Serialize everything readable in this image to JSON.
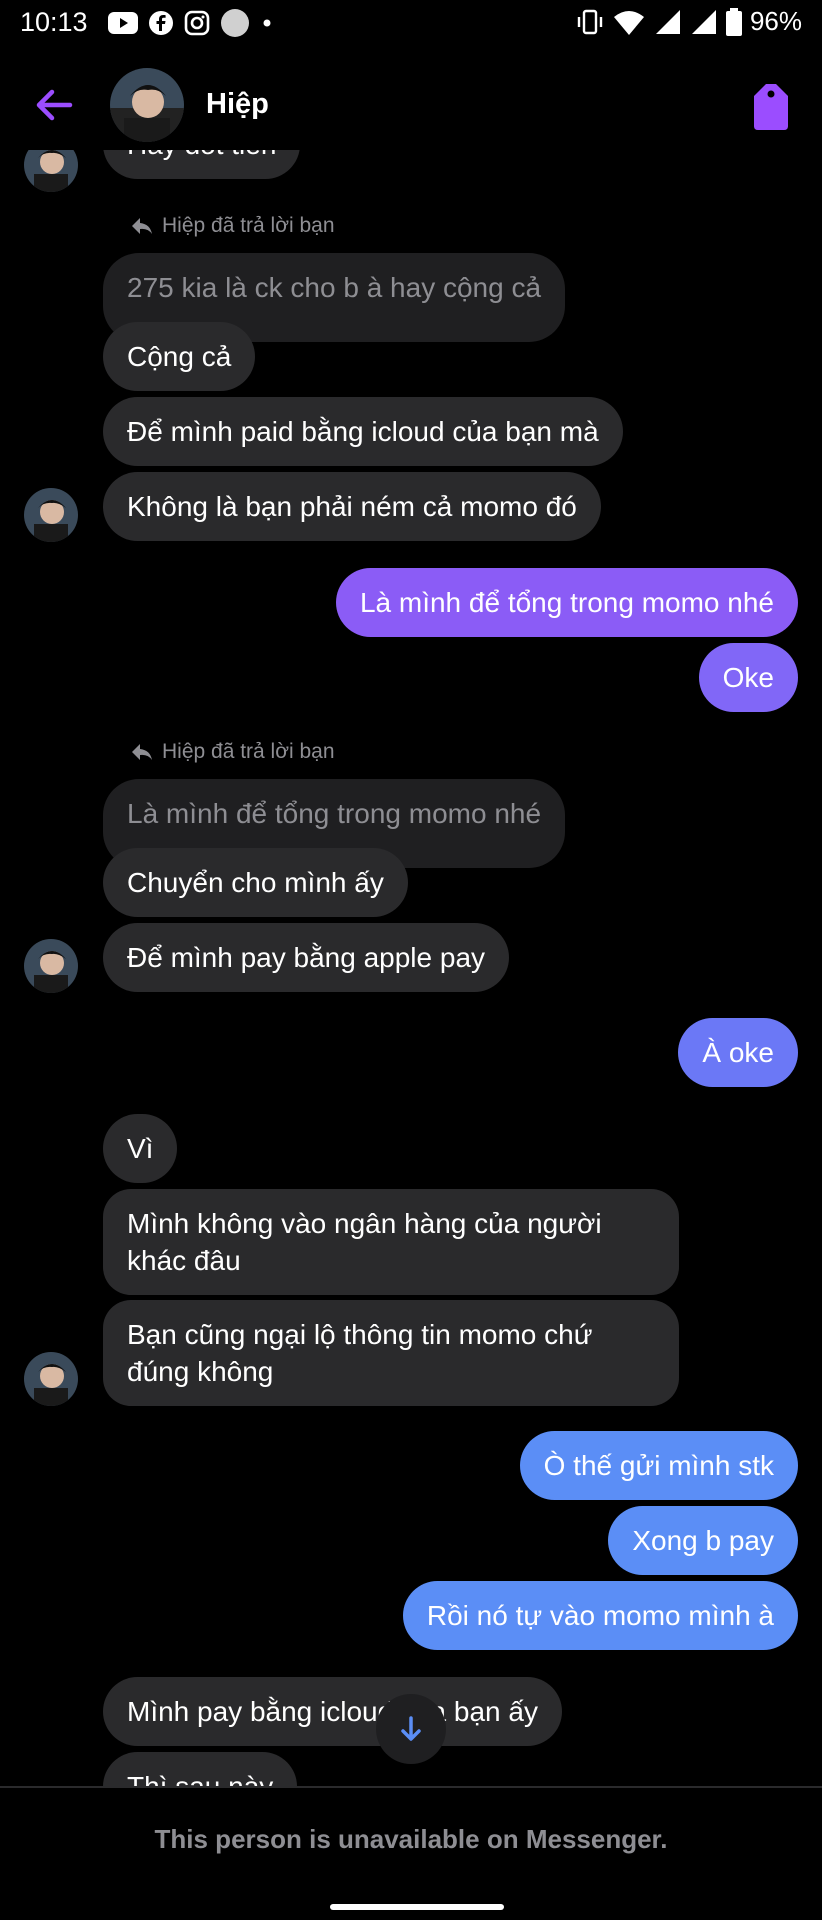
{
  "status_bar": {
    "time": "10:13",
    "battery": "96%",
    "icons": [
      "youtube-icon",
      "facebook-icon",
      "instagram-icon",
      "circle-icon",
      "dot-icon",
      "vibrate-icon",
      "wifi-icon",
      "signal-icon",
      "signal-icon",
      "battery-icon"
    ]
  },
  "header": {
    "contact_name": "Hiệp",
    "accent_color": "#9b4dff"
  },
  "colors": {
    "incoming_bubble": "#2a2a2c",
    "quoted_bubble": "#1f1f21",
    "outgoing_purple": "#8b5cf6",
    "outgoing_blue": "#5b8ef6"
  },
  "messages": {
    "m0": "Hay đốt tiền",
    "reply1_label": "Hiệp đã trả lời bạn",
    "reply1_quote": "275 kia là ck cho b à hay cộng cả",
    "m1": "Cộng cả",
    "m2": "Để mình paid bằng icloud của bạn mà",
    "m3": "Không là bạn phải ném cả momo đó",
    "o1": "Là mình để tổng trong momo nhé",
    "o2": "Oke",
    "reply2_label": "Hiệp đã trả lời bạn",
    "reply2_quote": "Là mình để tổng trong momo nhé",
    "m4": "Chuyển cho mình ấy",
    "m5": "Để mình pay bằng apple pay",
    "o3": "À oke",
    "m6": "Vì",
    "m7": "Mình không vào ngân hàng của người khác đâu",
    "m8": "Bạn cũng ngại lộ thông tin momo chứ đúng không",
    "o4": "Ò thế gửi mình stk",
    "o5": "Xong b pay",
    "o6": "Rồi nó tự vào momo mình à",
    "m9": "Mình pay bằng icloud của bạn ấy",
    "m10": "Thì sau này"
  },
  "footer": {
    "text": "This person is unavailable on Messenger."
  }
}
